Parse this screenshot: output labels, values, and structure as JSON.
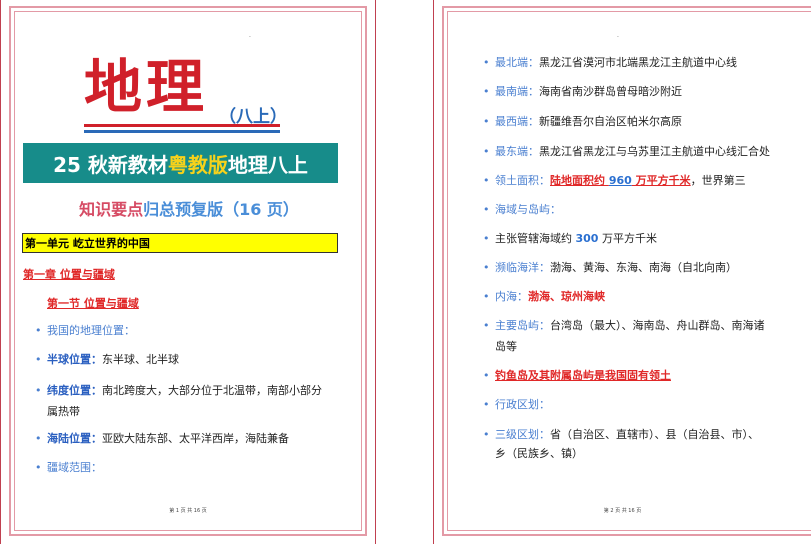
{
  "page1": {
    "title": "地理",
    "grade": "（八上）",
    "banner": {
      "part1": "25 秋新教材",
      "highlight": "粤教版",
      "part2": "地理八上"
    },
    "summary": {
      "part1": "知识要点",
      "part2": "归总预复版",
      "part3": "（16 页）"
    },
    "unit": "第一单元  屹立世界的中国",
    "chapter": "第一章  位置与疆域",
    "section": "第一节  位置与疆域",
    "items": [
      {
        "label": "我国的地理位置：",
        "text": ""
      },
      {
        "label": "半球位置：",
        "text": "东半球、北半球"
      },
      {
        "label": "纬度位置：",
        "text": "南北跨度大，大部分位于北温带，南部小部分"
      },
      {
        "label": "",
        "text": "属热带"
      },
      {
        "label": "海陆位置：",
        "text": "亚欧大陆东部、太平洋西岸，海陆兼备"
      },
      {
        "label": "疆域范围：",
        "text": ""
      }
    ],
    "footer": "第 1 页 共 16 页"
  },
  "page2": {
    "items": [
      {
        "label": "最北端：",
        "text": "黑龙江省漠河市北端黑龙江主航道中心线"
      },
      {
        "label": "最南端：",
        "text": "海南省南沙群岛曾母暗沙附近"
      },
      {
        "label": "最西端：",
        "text": "新疆维吾尔自治区帕米尔高原"
      },
      {
        "label": "最东端：",
        "text": "黑龙江省黑龙江与乌苏里江主航道中心线汇合处"
      },
      {
        "label": "领土面积：",
        "red": "陆地面积约 ",
        "value": "960",
        "red2": " 万平方千米",
        "text": "，世界第三"
      },
      {
        "label": "海域与岛屿：",
        "text": ""
      },
      {
        "text1": "主张管辖海域约 ",
        "value": "300",
        "text2": " 万平方千米"
      },
      {
        "label": "濒临海洋：",
        "text": "渤海、黄海、东海、南海（自北向南）"
      },
      {
        "label": "内海：",
        "red": "渤海、琼州海峡"
      },
      {
        "label": "主要岛屿：",
        "text": "台湾岛（最大）、海南岛、舟山群岛、南海诸"
      },
      {
        "text": "岛等"
      },
      {
        "red": "钓鱼岛及其附属岛屿是我国固有领土"
      },
      {
        "label": "行政区划：",
        "text": ""
      },
      {
        "label": "三级区划：",
        "text": "省（自治区、直辖市）、县（自治县、市）、"
      },
      {
        "text": "乡（民族乡、镇）"
      }
    ],
    "footer": "第 2 页 共 16 页"
  },
  "colors": {
    "title_red": "#d0202a",
    "banner_teal": "#178c8a",
    "banner_highlight": "#f7d21b",
    "unit_yellow": "#ffff00",
    "label_blue": "#4a7fd0",
    "frame_pink": "#e39aa6"
  }
}
